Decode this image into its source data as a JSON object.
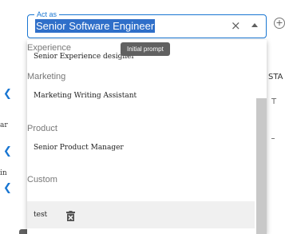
{
  "select": {
    "label": "Act as",
    "value": "Senior Software Engineer",
    "clear_icon": "×"
  },
  "tooltip": {
    "text": "Initial prompt"
  },
  "groups": [
    {
      "header": "Experience",
      "options": [
        {
          "label": "Senior Experience designer"
        }
      ]
    },
    {
      "header": "Marketing",
      "options": [
        {
          "label": "Marketing Writing Assistant"
        }
      ]
    },
    {
      "header": "Product",
      "options": [
        {
          "label": "Senior Product Manager"
        }
      ]
    },
    {
      "header": "Custom",
      "options": [
        {
          "label": "test"
        }
      ]
    }
  ],
  "background": {
    "right_panel_heading": "STA",
    "right_panel_text": "T",
    "side_text_1": "ar",
    "side_text_2": "in",
    "add_icon": "+"
  },
  "icons": {
    "share": "share-icon",
    "trash": "trash-icon",
    "dropdown": "arrow-up-icon",
    "clear": "close-icon",
    "add": "add-circle-icon"
  },
  "colors": {
    "accent": "#1976d2",
    "selection": "#2f6fc9",
    "tooltip": "#616161"
  }
}
